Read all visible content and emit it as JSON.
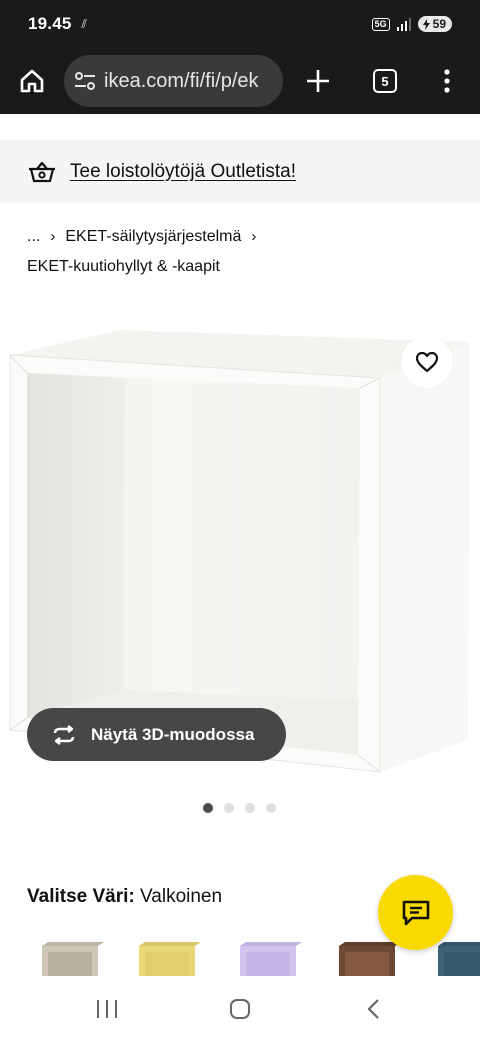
{
  "status_bar": {
    "time": "19.45",
    "notification": "⫽",
    "network": "5G",
    "battery": "59"
  },
  "browser": {
    "url": "ikea.com/fi/fi/p/ek",
    "tab_count": "5"
  },
  "outlet_banner": {
    "text": "Tee loistolöytöjä Outletista!"
  },
  "breadcrumb": {
    "ellipsis": "...",
    "sep": "›",
    "item1": "EKET-säilytysjärjestelmä",
    "item2": "EKET-kuutiohyllyt & -kaapit"
  },
  "product": {
    "view_3d_label": "Näytä 3D-muodossa",
    "image_count": 4,
    "active_image": 1,
    "color_label": "Valitse Väri:",
    "color_value": "Valkoinen",
    "swatch_colors": [
      "#cfc7b5",
      "#e8d87a",
      "#cfc3ef",
      "#6e4a36",
      "#3c6276"
    ]
  },
  "colors": {
    "accent_yellow": "#f8d900",
    "browser_dark": "#1a1a1c"
  }
}
